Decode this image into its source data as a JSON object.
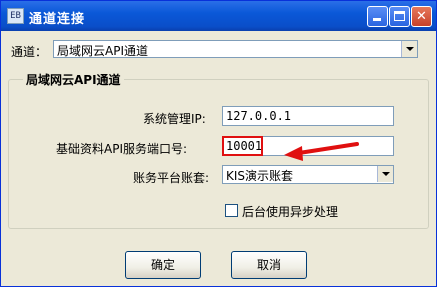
{
  "window": {
    "title": "通道连接",
    "icon_name": "app-window-icon",
    "icon_text": "EB"
  },
  "title_buttons": {
    "minimize": "minimize-icon",
    "maximize": "maximize-icon",
    "close": "close-icon",
    "close_glyph": "✕"
  },
  "channel": {
    "label": "通道：",
    "selected": "局域网云API通道"
  },
  "group": {
    "title": "局域网云API通道",
    "ip_label": "系统管理IP:",
    "ip_value": "127.0.0.1",
    "port_label": "基础资料API服务端口号:",
    "port_value": "10001",
    "account_label": "账务平台账套:",
    "account_value": "KIS演示账套",
    "async_label": "后台使用异步处理",
    "async_checked": false
  },
  "buttons": {
    "ok": "确定",
    "cancel": "取消"
  },
  "annotation": {
    "highlight_color": "#e01010",
    "arrow": "red-arrow-icon"
  },
  "colors": {
    "titlebar": "#0a58d8",
    "dialog_bg": "#ece9d8",
    "input_border": "#7f9db9"
  }
}
